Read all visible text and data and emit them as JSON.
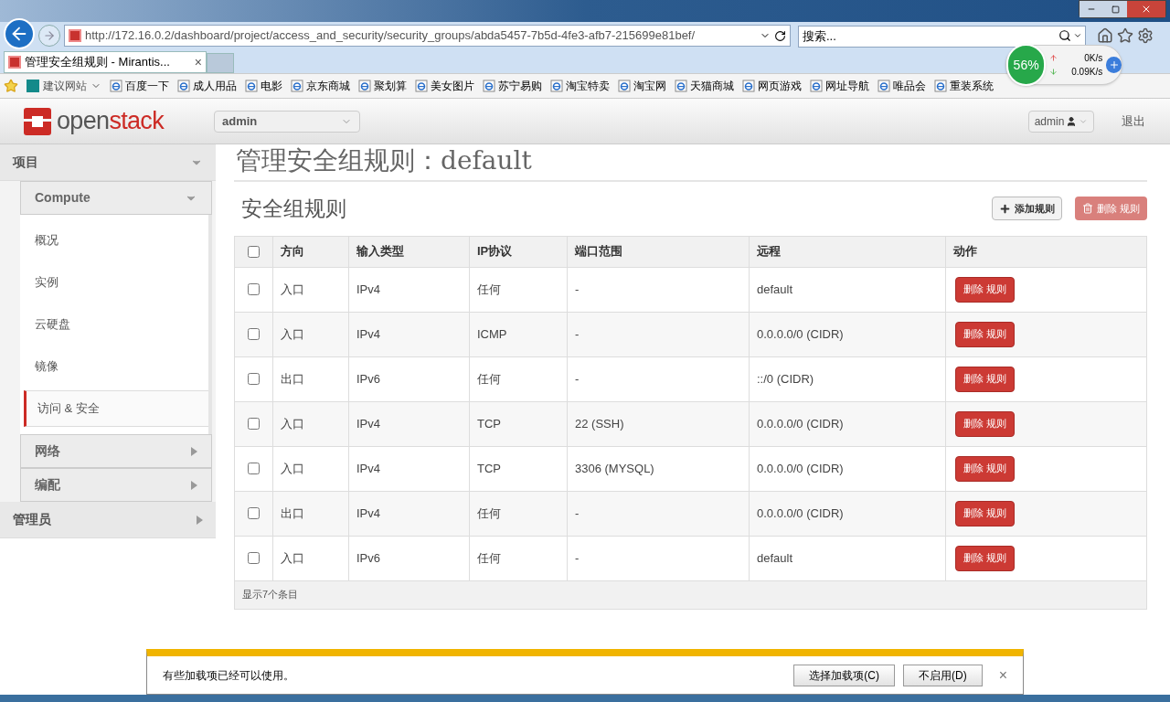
{
  "browser": {
    "url": "http://172.16.0.2/dashboard/project/access_and_security/security_groups/abda5457-7b5d-4fe3-afb7-215699e81bef/",
    "search_placeholder": "搜索...",
    "tab_title": "管理安全组规则 - Mirantis...",
    "tab_close": "×",
    "favorites": [
      {
        "label": "建议网站",
        "kind": "dropdown"
      },
      {
        "label": "百度一下",
        "kind": "link"
      },
      {
        "label": "成人用品",
        "kind": "link"
      },
      {
        "label": "电影",
        "kind": "link"
      },
      {
        "label": "京东商城",
        "kind": "link"
      },
      {
        "label": "聚划算",
        "kind": "link"
      },
      {
        "label": "美女图片",
        "kind": "link"
      },
      {
        "label": "苏宁易购",
        "kind": "link"
      },
      {
        "label": "淘宝特卖",
        "kind": "link"
      },
      {
        "label": "淘宝网",
        "kind": "link"
      },
      {
        "label": "天猫商城",
        "kind": "link"
      },
      {
        "label": "网页游戏",
        "kind": "link"
      },
      {
        "label": "网址导航",
        "kind": "link"
      },
      {
        "label": "唯品会",
        "kind": "link"
      },
      {
        "label": "重装系统",
        "kind": "link"
      }
    ],
    "speed_widget": {
      "percent": "56%",
      "upload": "0K/s",
      "download": "0.09K/s"
    }
  },
  "header": {
    "logo_a": "open",
    "logo_b": "stack",
    "project": "admin",
    "user": "admin",
    "logout": "退出"
  },
  "sidebar": {
    "sections": [
      {
        "label": "项目",
        "expanded": true,
        "groups": [
          {
            "label": "Compute",
            "expanded": true,
            "items": [
              {
                "label": "概况",
                "selected": false
              },
              {
                "label": "实例",
                "selected": false
              },
              {
                "label": "云硬盘",
                "selected": false
              },
              {
                "label": "镜像",
                "selected": false
              },
              {
                "label": "访问 & 安全",
                "selected": true
              }
            ]
          },
          {
            "label": "网络",
            "expanded": false
          },
          {
            "label": "编配",
            "expanded": false
          }
        ]
      },
      {
        "label": "管理员",
        "expanded": false
      }
    ]
  },
  "page_title": "管理安全组规则：default",
  "table": {
    "title": "安全组规则",
    "add_button": "添加规则",
    "delete_button": "删除 规则",
    "select_all_checked": false,
    "columns": [
      "方向",
      "输入类型",
      "IP协议",
      "端口范围",
      "远程",
      "动作"
    ],
    "rows": [
      {
        "cells": [
          "入口",
          "IPv4",
          "任何",
          "-",
          "default"
        ],
        "checked": false,
        "action": "删除 规则"
      },
      {
        "cells": [
          "入口",
          "IPv4",
          "ICMP",
          "-",
          "0.0.0.0/0 (CIDR)"
        ],
        "checked": false,
        "action": "删除 规则"
      },
      {
        "cells": [
          "出口",
          "IPv6",
          "任何",
          "-",
          "::/0 (CIDR)"
        ],
        "checked": false,
        "action": "删除 规则"
      },
      {
        "cells": [
          "入口",
          "IPv4",
          "TCP",
          "22 (SSH)",
          "0.0.0.0/0 (CIDR)"
        ],
        "checked": false,
        "action": "删除 规则"
      },
      {
        "cells": [
          "入口",
          "IPv4",
          "TCP",
          "3306 (MYSQL)",
          "0.0.0.0/0 (CIDR)"
        ],
        "checked": false,
        "action": "删除 规则"
      },
      {
        "cells": [
          "出口",
          "IPv4",
          "任何",
          "-",
          "0.0.0.0/0 (CIDR)"
        ],
        "checked": false,
        "action": "删除 规则"
      },
      {
        "cells": [
          "入口",
          "IPv6",
          "任何",
          "-",
          "default"
        ],
        "checked": false,
        "action": "删除 规则"
      }
    ],
    "footer": "显示7个条目"
  },
  "notification": {
    "message": "有些加载项已经可以使用。",
    "buttons": [
      "选择加载项(C)",
      "不启用(D)"
    ],
    "close": "×"
  }
}
